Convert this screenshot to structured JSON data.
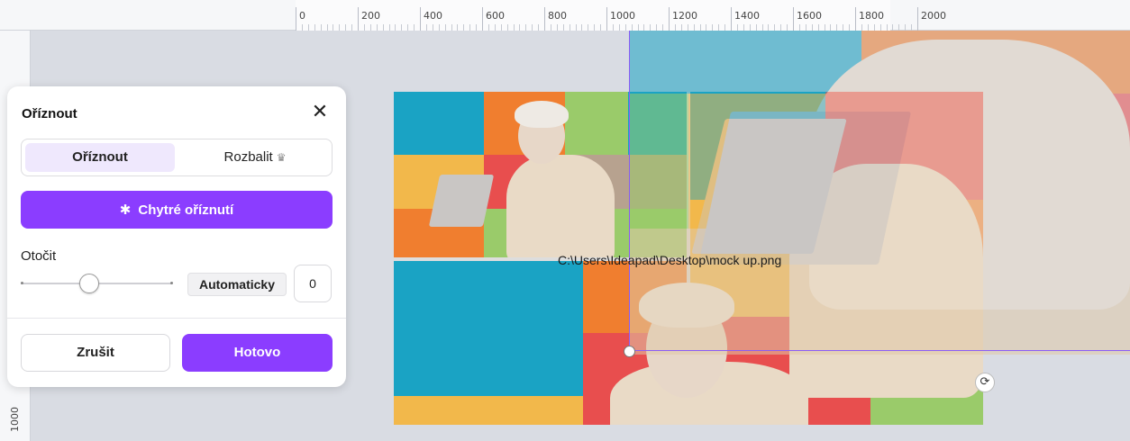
{
  "ruler": {
    "top_labels": [
      "0",
      "200",
      "400",
      "600",
      "800",
      "1000",
      "1200",
      "1400",
      "1600",
      "1800",
      "2000"
    ],
    "left_label": "1000"
  },
  "canvas": {
    "file_path": "C:\\Users\\Ideapad\\Desktop\\mock up.png",
    "tile_colors": [
      "#1aa3c4",
      "#f07e2f",
      "#f2b84b",
      "#e84e4e",
      "#9acb6a",
      "#b7a28f"
    ]
  },
  "panel": {
    "title": "Oříznout",
    "close_icon": "close-icon",
    "tabs": [
      {
        "label": "Oříznout",
        "active": true
      },
      {
        "label": "Rozbalit",
        "active": false,
        "badge_icon": "crown-icon"
      }
    ],
    "smart_crop": {
      "icon": "sparkle-icon",
      "label": "Chytré oříznutí"
    },
    "rotate": {
      "label": "Otočit",
      "auto_label": "Automaticky",
      "angle_value": "0",
      "slider_level": 0.45
    },
    "cancel_label": "Zrušit",
    "done_label": "Hotovo"
  },
  "colors": {
    "accent": "#8b3dff",
    "accent_light": "#efe8fd",
    "crop_frame": "#8b5cf6"
  }
}
